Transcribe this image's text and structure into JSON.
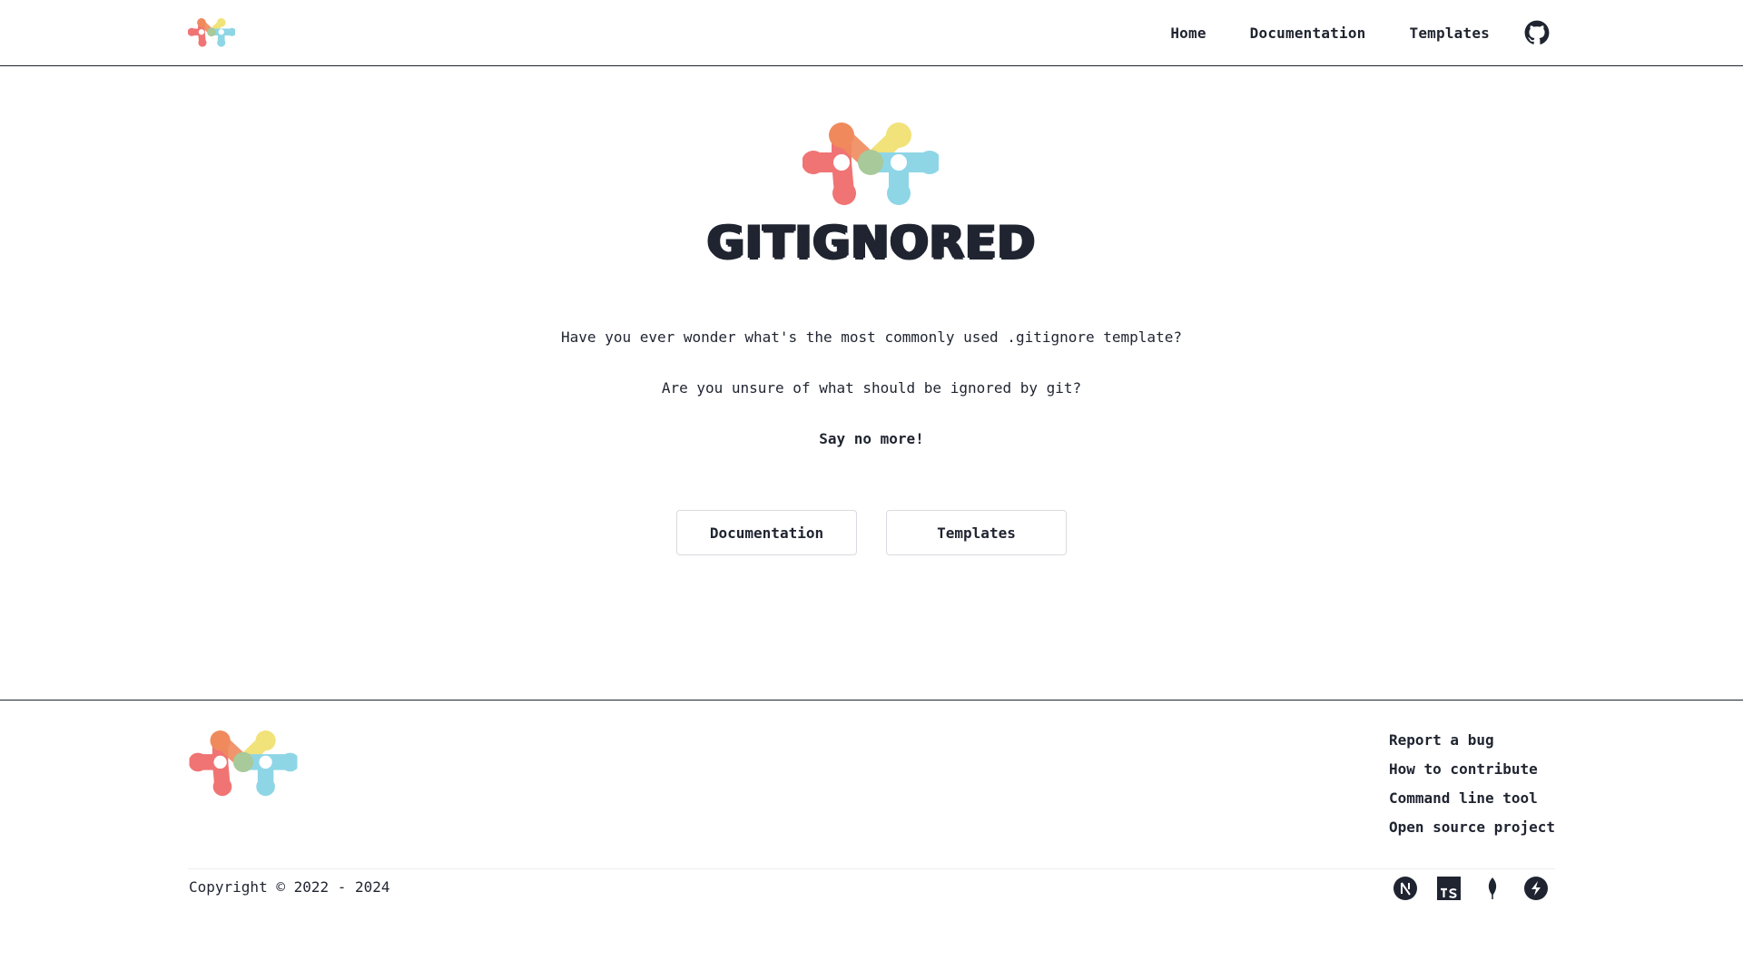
{
  "header": {
    "logo_icon": "gitignored-logo-icon",
    "nav": [
      {
        "label": "Home"
      },
      {
        "label": "Documentation"
      },
      {
        "label": "Templates"
      }
    ],
    "github_icon": "github-icon"
  },
  "hero": {
    "logo_icon": "gitignored-logo-icon",
    "title": "GITIGNORED",
    "line1": "Have you ever wonder what's the most commonly used .gitignore template?",
    "line2": "Are you unsure of what should be ignored by git?",
    "line3": "Say no more!",
    "buttons": {
      "documentation": "Documentation",
      "templates": "Templates"
    }
  },
  "footer": {
    "logo_icon": "gitignored-logo-icon",
    "links": [
      {
        "label": "Report a bug"
      },
      {
        "label": "How to contribute"
      },
      {
        "label": "Command line tool"
      },
      {
        "label": "Open source project"
      }
    ],
    "copyright": "Copyright © 2022 - 2024",
    "tech_icons": [
      "nextjs-icon",
      "typescript-icon",
      "mongodb-icon",
      "supabase-icon"
    ]
  },
  "colors": {
    "logo_red": "#f07474",
    "logo_orange": "#f08a5d",
    "logo_yellow": "#f1e27a",
    "logo_green": "#a8c99a",
    "logo_blue": "#8ed6e6",
    "text": "#1f2430"
  }
}
